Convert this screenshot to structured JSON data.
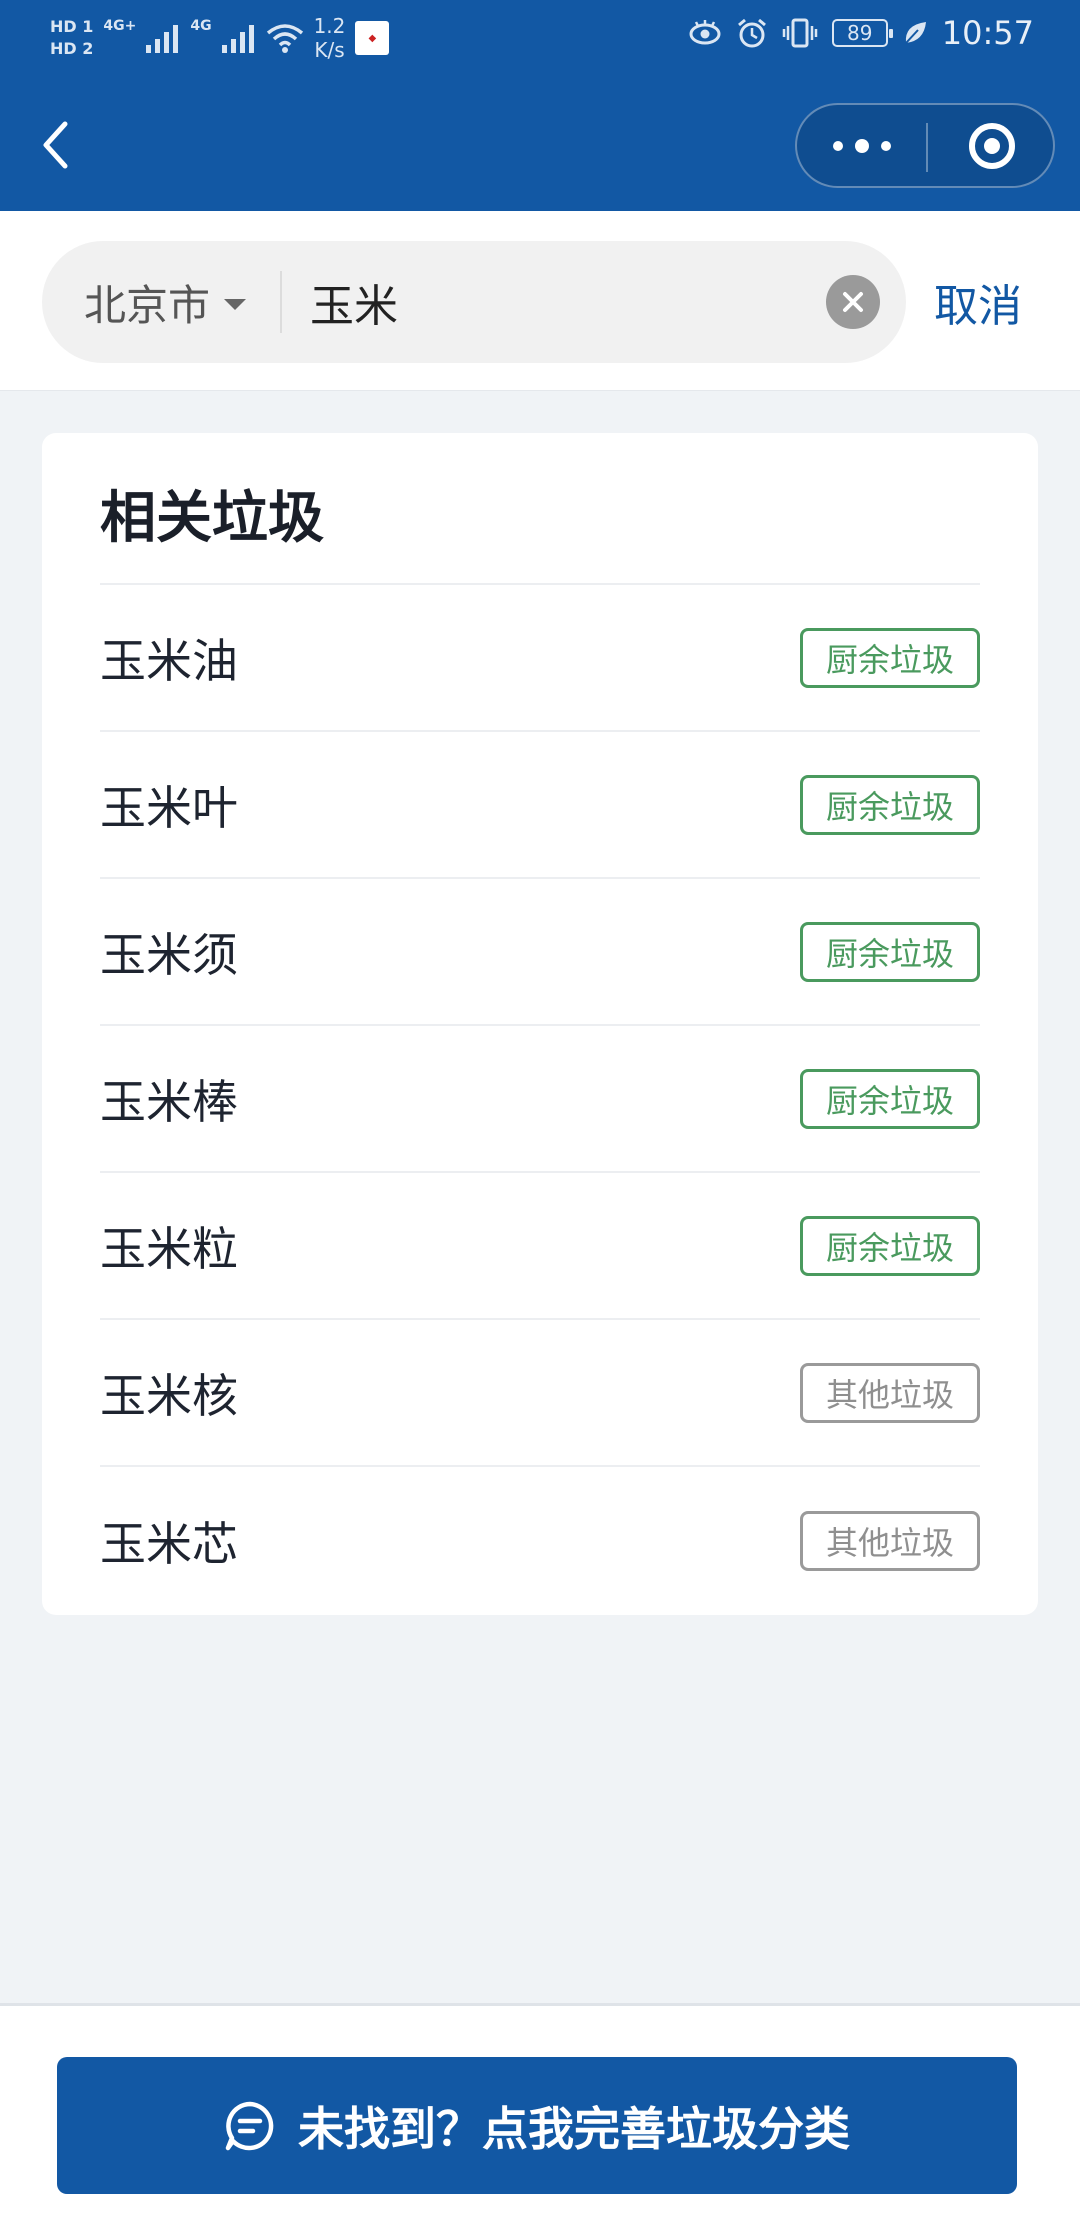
{
  "status_bar": {
    "hd_1": "HD 1",
    "hd_2": "HD 2",
    "network_1": "4G+",
    "network_2": "4G",
    "speed_value": "1.2",
    "speed_unit": "K/s",
    "battery": "89",
    "time": "10:57"
  },
  "nav": {
    "back_icon": "chevron-left-icon",
    "more_icon": "more-dots-icon",
    "close_icon": "target-circle-icon"
  },
  "search": {
    "city": "北京市",
    "query": "玉米",
    "cancel_label": "取消"
  },
  "results": {
    "title": "相关垃圾",
    "items": [
      {
        "name": "玉米油",
        "category": "厨余垃圾",
        "type": "food"
      },
      {
        "name": "玉米叶",
        "category": "厨余垃圾",
        "type": "food"
      },
      {
        "name": "玉米须",
        "category": "厨余垃圾",
        "type": "food"
      },
      {
        "name": "玉米棒",
        "category": "厨余垃圾",
        "type": "food"
      },
      {
        "name": "玉米粒",
        "category": "厨余垃圾",
        "type": "food"
      },
      {
        "name": "玉米核",
        "category": "其他垃圾",
        "type": "other"
      },
      {
        "name": "玉米芯",
        "category": "其他垃圾",
        "type": "other"
      }
    ]
  },
  "feedback": {
    "label": "未找到？点我完善垃圾分类",
    "icon": "chat-bubble-icon"
  },
  "colors": {
    "primary": "#1258a4",
    "food_tag": "#4a9a5e",
    "other_tag": "#9a9a9a"
  }
}
